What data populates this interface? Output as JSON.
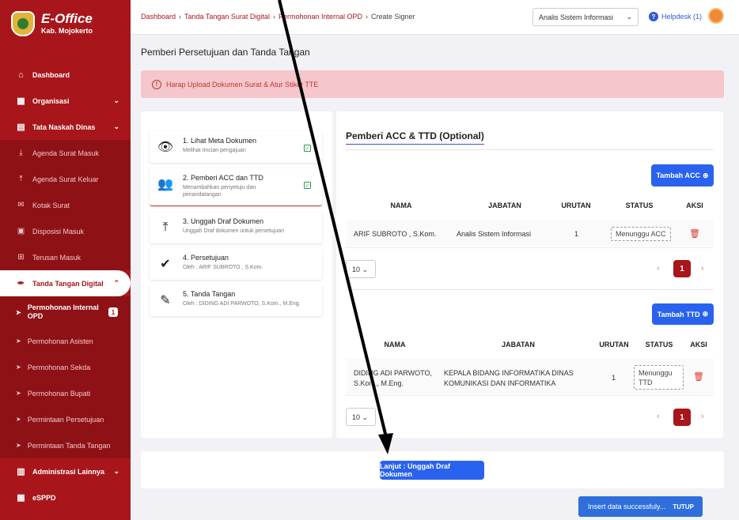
{
  "sidebar": {
    "app_title": "E-Office",
    "app_subtitle": "Kab. Mojokerto",
    "items": [
      {
        "label": "Dashboard",
        "icon": "home-icon"
      },
      {
        "label": "Organisasi",
        "icon": "building-icon"
      },
      {
        "label": "Tata Naskah Dinas",
        "icon": "document-icon"
      },
      {
        "label": "Agenda Surat Masuk",
        "icon": "inbox-download-icon"
      },
      {
        "label": "Agenda Surat Keluar",
        "icon": "upload-icon"
      },
      {
        "label": "Kotak Surat",
        "icon": "mail-icon"
      },
      {
        "label": "Disposisi Masuk",
        "icon": "tray-icon"
      },
      {
        "label": "Terusan Masuk",
        "icon": "forward-box-icon"
      },
      {
        "label": "Tanda Tangan Digital",
        "icon": "pen-icon"
      },
      {
        "label": "Permohonan Internal OPD",
        "badge": "1"
      },
      {
        "label": "Permohonan Asisten"
      },
      {
        "label": "Permohonan Sekda"
      },
      {
        "label": "Permohonan Bupati"
      },
      {
        "label": "Permintaan Persetujuan"
      },
      {
        "label": "Permintaan Tanda Tangan"
      },
      {
        "label": "Administrasi Lainnya",
        "icon": "folder-icon"
      },
      {
        "label": "eSPPD",
        "icon": "building-icon"
      }
    ]
  },
  "topbar": {
    "breadcrumb": [
      "Dashboard",
      "Tanda Tangan Surat Digital",
      "Permohonan Internal OPD",
      "Create Signer"
    ],
    "role_select": "Analis Sistem Informasi",
    "helpdesk": "Helpdesk (1)"
  },
  "page": {
    "title": "Pemberi Persetujuan dan Tanda Tangan",
    "alert": "Harap Upload Dokumen Surat & Atur Stiker TTE"
  },
  "steps": [
    {
      "title": "1. Lihat Meta Dokumen",
      "subtitle": "Melihat rincian pengajuan",
      "icon": "eye-icon",
      "done": true
    },
    {
      "title": "2. Pemberi ACC dan TTD",
      "subtitle": "Menambahkan penyetuju dan penandatangan",
      "icon": "users-icon",
      "done": true
    },
    {
      "title": "3. Unggah Draf Dokumen",
      "subtitle": "Unggah Draf dokumen untuk persetujuan",
      "icon": "upload-icon",
      "done": false
    },
    {
      "title": "4. Persetujuan",
      "subtitle": "Oleh : ARIF SUBROTO , S.Kom.",
      "icon": "user-check-icon",
      "done": false
    },
    {
      "title": "5. Tanda Tangan",
      "subtitle": "Oleh : DIDING ADI PARWOTO, S.Kom., M.Eng.",
      "icon": "pen-icon",
      "done": false
    }
  ],
  "panel": {
    "title": "Pemberi ACC & TTD (Optional)",
    "acc": {
      "add_button": "Tambah ACC",
      "headers": [
        "NAMA",
        "JABATAN",
        "URUTAN",
        "STATUS",
        "AKSI"
      ],
      "rows": [
        {
          "nama": "ARIF SUBROTO , S.Kom.",
          "jabatan": "Analis Sistem Informasi",
          "urutan": "1",
          "status": "Menunggu ACC"
        }
      ],
      "page_size": "10",
      "page": "1"
    },
    "ttd": {
      "add_button": "Tambah TTD",
      "headers": [
        "NAMA",
        "JABATAN",
        "URUTAN",
        "STATUS",
        "AKSI"
      ],
      "rows": [
        {
          "nama_line1": "DIDING ADI PARWOTO,",
          "nama_line2": "S.Kom., M.Eng.",
          "jabatan_line1": "KEPALA BIDANG INFORMATIKA DINAS",
          "jabatan_line2": "KOMUNIKASI DAN INFORMATIKA",
          "urutan": "1",
          "status_line1": "Menunggu",
          "status_line2": "TTD"
        }
      ],
      "page_size": "10",
      "page": "1"
    }
  },
  "next_button": "Lanjut : Unggah Draf Dokumen",
  "toast": {
    "message": "Insert data successfuly...",
    "close": "TUTUP"
  }
}
